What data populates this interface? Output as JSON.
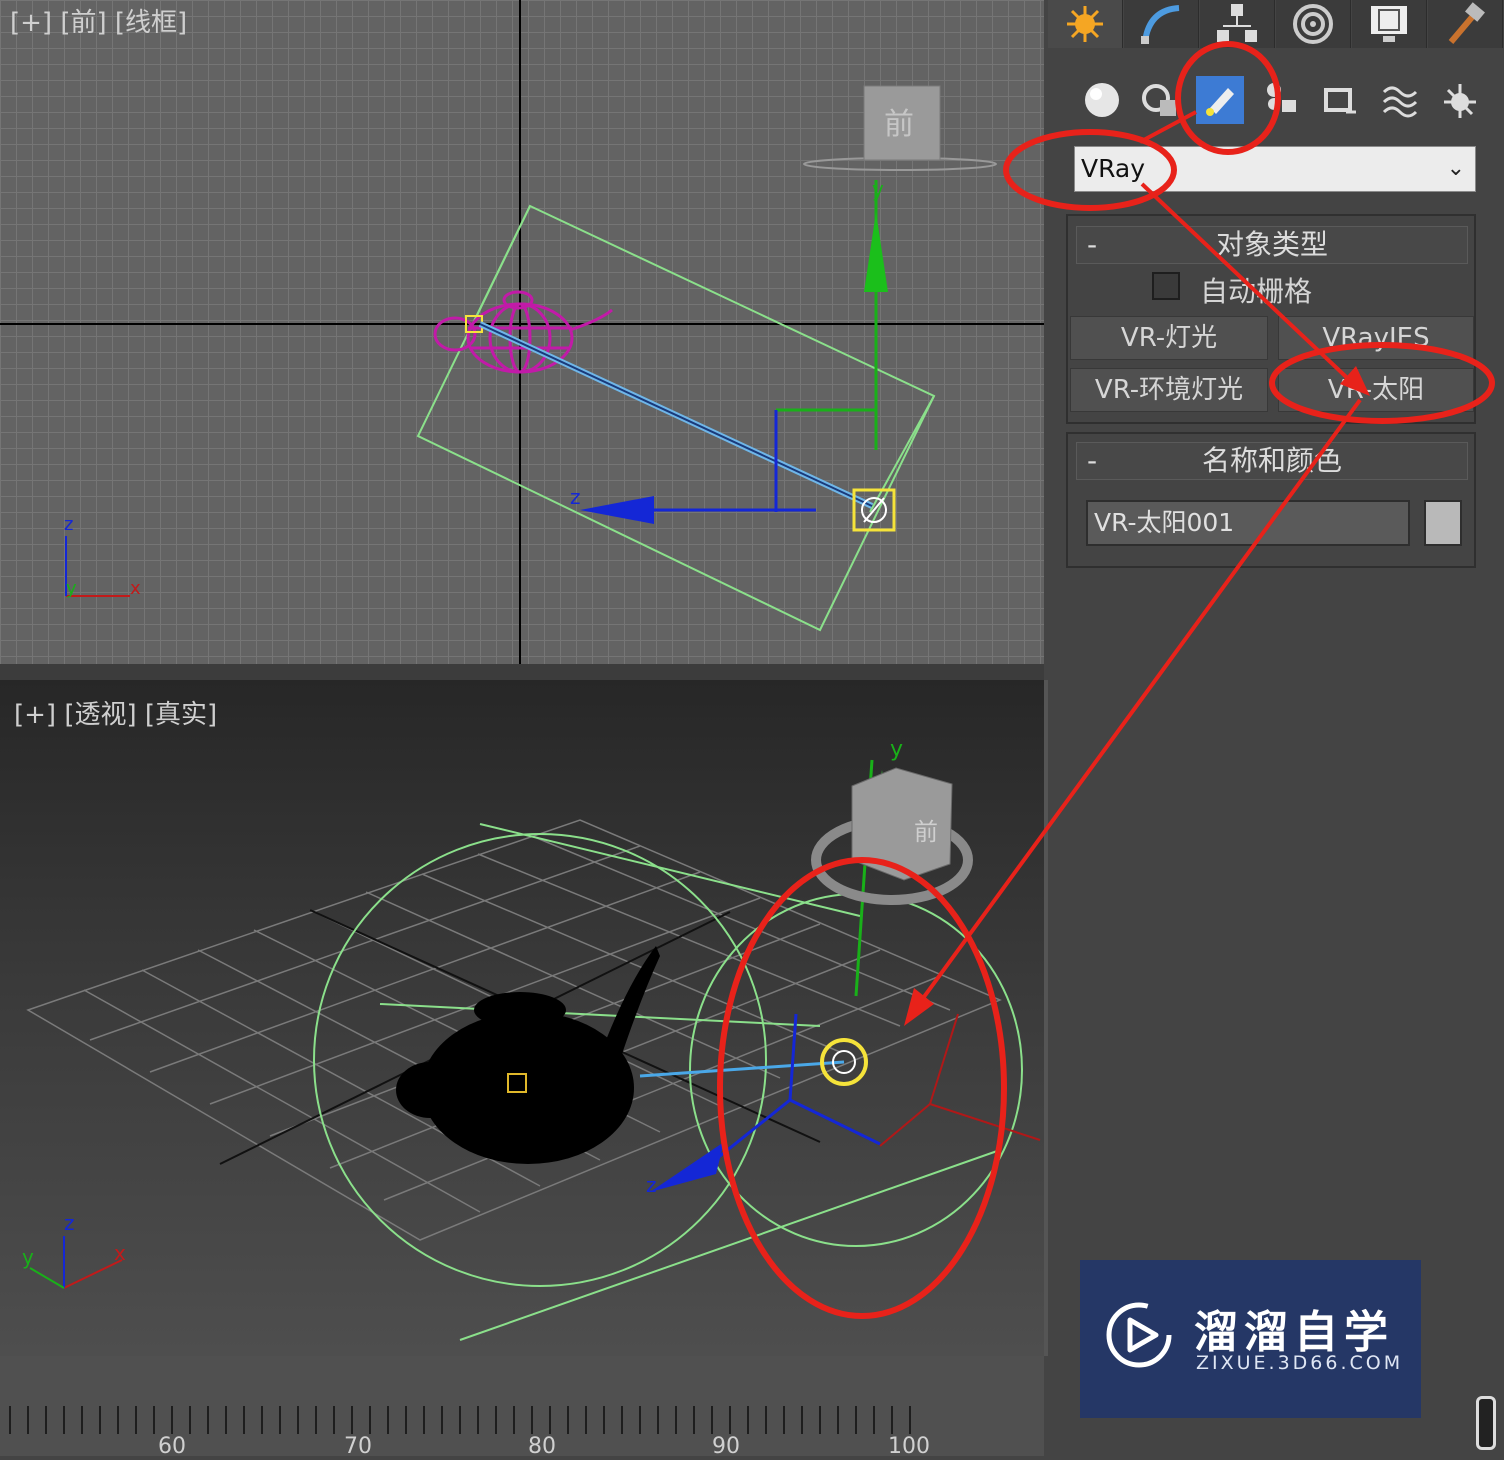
{
  "viewports": {
    "front": {
      "label": "[+] [前] [线框]"
    },
    "perspective": {
      "label": "[+] [透视] [真实]"
    },
    "viewcube": {
      "front_face": "前"
    },
    "axes": {
      "x": "x",
      "y": "y",
      "z": "z"
    }
  },
  "command_panel": {
    "tabs": [
      "create-icon",
      "modify-icon",
      "hierarchy-icon",
      "motion-icon",
      "display-icon",
      "utilities-icon"
    ],
    "subcategories": [
      "geometry-icon",
      "shapes-icon",
      "lights-icon",
      "cameras-icon",
      "helpers-icon",
      "spacewarps-icon",
      "systems-icon"
    ],
    "active_subcategory": "lights-icon",
    "renderer_dropdown": {
      "value": "VRay"
    },
    "object_type": {
      "title": "对象类型",
      "collapse": "-",
      "autogrid_label": "自动栅格",
      "buttons": [
        "VR-灯光",
        "VRayIES",
        "VR-环境灯光",
        "VR-太阳"
      ]
    },
    "name_color": {
      "title": "名称和颜色",
      "collapse": "-",
      "name_value": "VR-太阳001",
      "color": "#b9b9b9"
    }
  },
  "timeline": {
    "ticks": [
      "60",
      "70",
      "80",
      "90",
      "100"
    ]
  },
  "watermark": {
    "name": "溜溜自学",
    "url": "ZIXUE.3D66.COM"
  },
  "colors": {
    "annotation_red": "#e8221a",
    "selection_yellow": "#f5e33a",
    "light_green": "#8be08b",
    "teapot_magenta": "#c21aa8",
    "axis_blue": "#1427d6",
    "axis_green": "#19b019",
    "accent_blue": "#3d7bd4"
  }
}
